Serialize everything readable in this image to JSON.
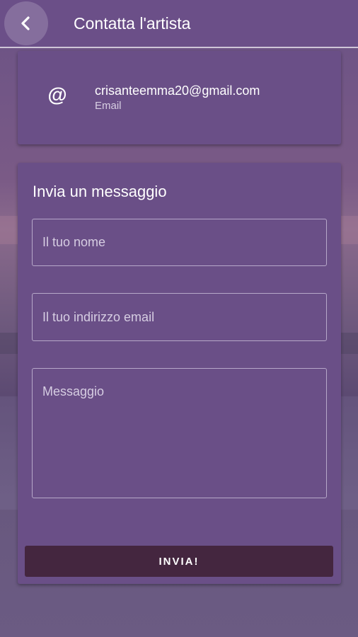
{
  "header": {
    "title": "Contatta l'artista"
  },
  "contact": {
    "value": "crisanteemma20@gmail.com",
    "label": "Email"
  },
  "form": {
    "title": "Invia un messaggio",
    "name_placeholder": "Il tuo nome",
    "email_placeholder": "Il tuo indirizzo email",
    "message_placeholder": "Messaggio",
    "submit_label": "INVIA!"
  },
  "colors": {
    "appbar": "#6b4f88",
    "card": "#6a4f87",
    "submit": "#44263f"
  },
  "icons": {
    "back": "chevron-left-icon",
    "email": "at-sign-icon"
  }
}
